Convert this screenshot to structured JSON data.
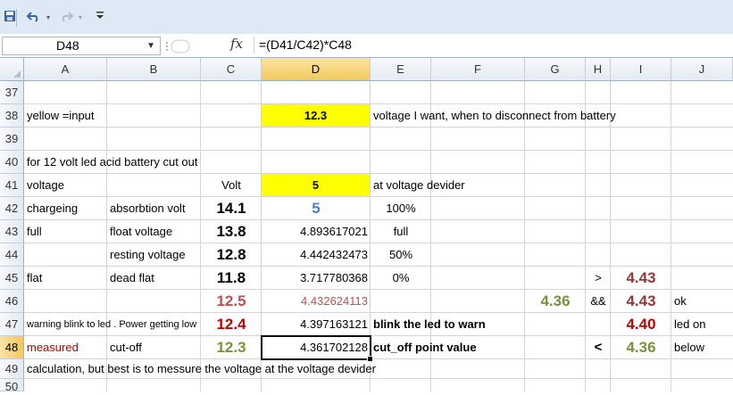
{
  "toolbar": {
    "save_icon": "save-icon",
    "undo_icon": "undo-icon",
    "redo_icon": "redo-icon",
    "customize_icon": "customize-qat-icon"
  },
  "formula_bar": {
    "name_box": "D48",
    "fx_label": "fx",
    "formula": "=(D41/C42)*C48"
  },
  "columns": [
    "A",
    "B",
    "C",
    "D",
    "E",
    "F",
    "G",
    "H",
    "I",
    "J"
  ],
  "rows": [
    "37",
    "38",
    "39",
    "40",
    "41",
    "42",
    "43",
    "44",
    "45",
    "46",
    "47",
    "48",
    "49",
    "50"
  ],
  "cells": {
    "A38": "yellow =input",
    "D38": "12.3",
    "E38": "voltage I want, when to disconnect from battery",
    "A40": "for 12 volt led acid battery cut out",
    "A41": "voltage",
    "C41": "Volt",
    "D41": "5",
    "E41": "at voltage devider",
    "A42": "chargeing",
    "B42": "absorbtion volt",
    "C42": "14.1",
    "D42": "5",
    "E42": "100%",
    "A43": "full",
    "B43": "float voltage",
    "C43": "13.8",
    "D43": "4.893617021",
    "E43": "full",
    "B44": "resting voltage",
    "C44": "12.8",
    "D44": "4.442432473",
    "E44": "50%",
    "A45": "flat",
    "B45": "dead flat",
    "C45": "11.8",
    "D45": "3.717780368",
    "E45": "0%",
    "H45": ">",
    "I45": "4.43",
    "C46": "12.5",
    "D46": "4.432624113",
    "G46": "4.36",
    "H46": "&&",
    "I46": "4.43",
    "J46": "ok",
    "A47": "warning blink to led . Power getting low",
    "C47": "12.4",
    "D47": "4.397163121",
    "E47": "blink the led to warn",
    "I47": "4.40",
    "J47": "led on",
    "A48": "measured",
    "B48": "cut-off",
    "C48": "12.3",
    "D48": "4.361702128",
    "E48": "cut_off point value",
    "H48": "<",
    "I48": "4.36",
    "J48": "below",
    "A49": "calculation, but best is to messure the voltage at the voltage devider"
  },
  "colors": {
    "input_fill": "#ffff00",
    "red": "#c00000",
    "dark_red": "#953734",
    "green": "#76923c",
    "blue": "#4f81bd",
    "selected_header": "#f2c95c"
  }
}
